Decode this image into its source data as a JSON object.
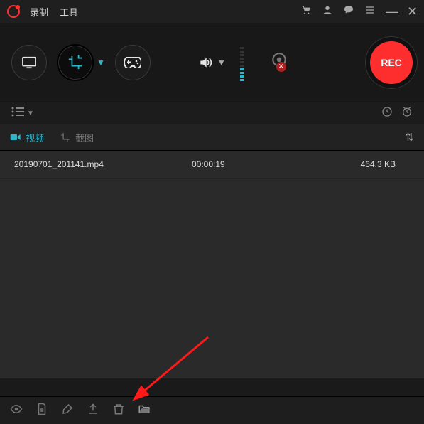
{
  "menu": {
    "record": "录制",
    "tools": "工具"
  },
  "toolbar": {
    "rec": "REC"
  },
  "tabs": {
    "video": "视频",
    "screenshot": "截图"
  },
  "files": [
    {
      "name": "20190701_201141.mp4",
      "duration": "00:00:19",
      "size": "464.3 KB"
    }
  ],
  "colors": {
    "accent": "#2bb7c9",
    "record": "#ff2e2e",
    "bg": "#1a1a1a"
  }
}
